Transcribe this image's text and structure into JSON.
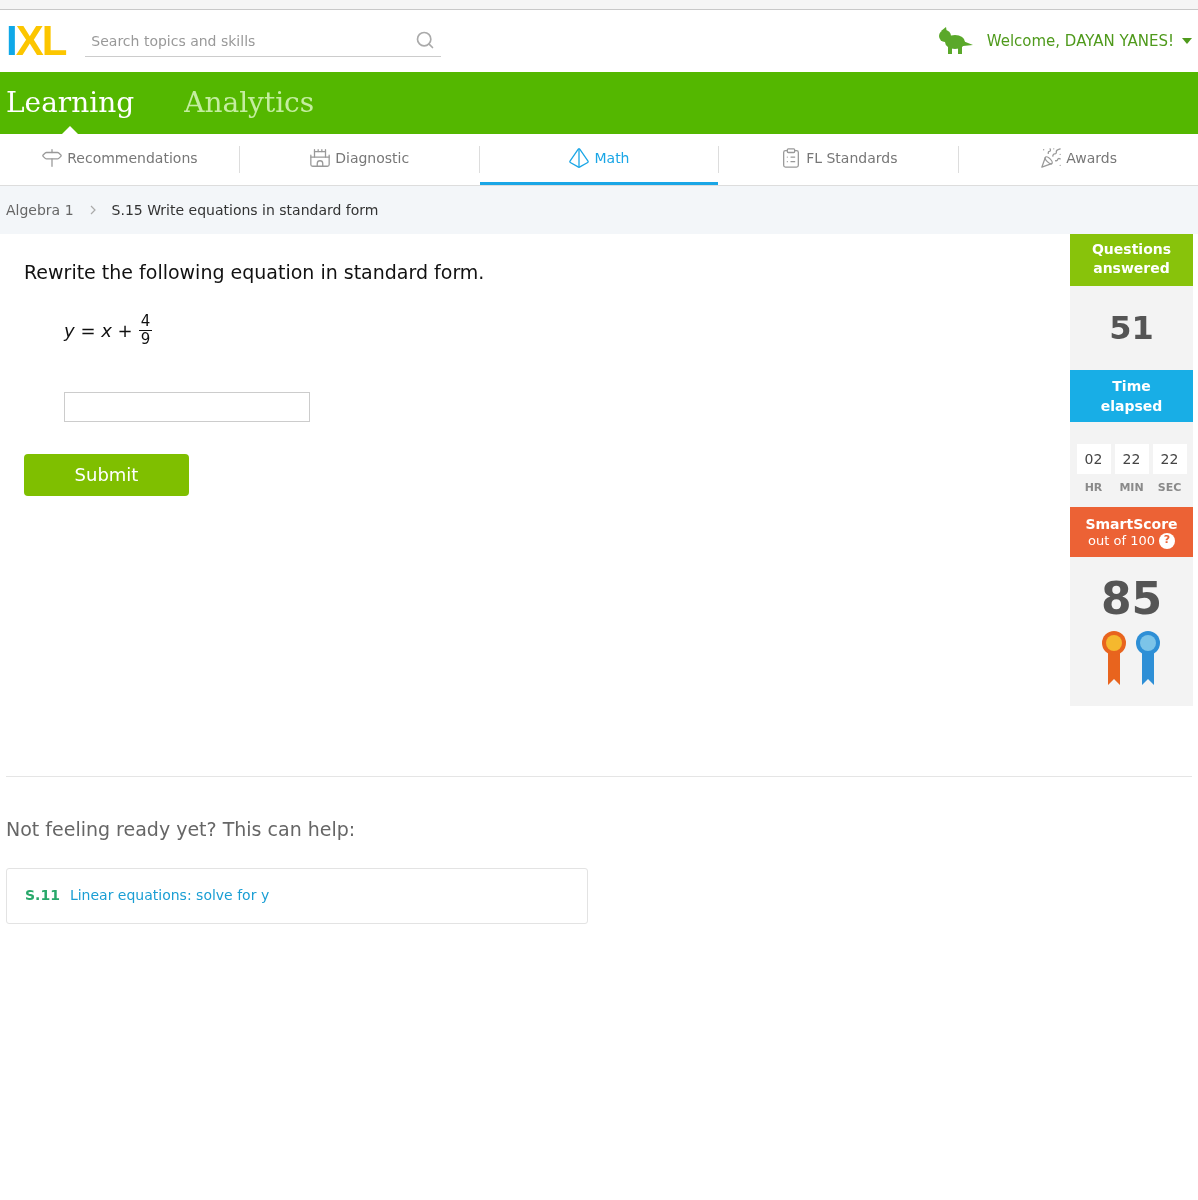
{
  "logo": {
    "letters": [
      {
        "text": "I",
        "color": "#0fa8e8"
      },
      {
        "text": "XL",
        "color": "#fcc600"
      }
    ]
  },
  "search": {
    "placeholder": "Search topics and skills"
  },
  "user": {
    "welcome": "Welcome, DAYAN YANES!"
  },
  "sections": [
    {
      "label": "Learning",
      "selected": true
    },
    {
      "label": "Analytics",
      "selected": false
    }
  ],
  "tabs": [
    {
      "label": "Recommendations",
      "kind": "signpost",
      "selected": false
    },
    {
      "label": "Diagnostic",
      "kind": "castle",
      "selected": false
    },
    {
      "label": "Math",
      "kind": "pyramid",
      "selected": true
    },
    {
      "label": "FL Standards",
      "kind": "clipboard",
      "selected": false
    },
    {
      "label": "Awards",
      "kind": "party",
      "selected": false
    }
  ],
  "breadcrumb": [
    "Algebra 1",
    "S.15 Write equations in standard form"
  ],
  "question": {
    "prompt": "Rewrite the following equation in standard form.",
    "lhs": "*y* = *x* +",
    "numerator": "4",
    "denominator": "9"
  },
  "submit": "Submit",
  "stats": {
    "answered_title": "Questions answered",
    "answered": "51",
    "time_title": "Time elapsed",
    "time": [
      {
        "value": "02",
        "unit": "HR"
      },
      {
        "value": "22",
        "unit": "MIN"
      },
      {
        "value": "22",
        "unit": "SEC"
      }
    ],
    "score_title": "SmartScore",
    "score_subtitle": "out of 100",
    "help": "?",
    "score": "85"
  },
  "help_section": {
    "title": "Not feeling ready yet? This can help:",
    "skills": [
      {
        "code": "S.11",
        "name": "Linear equations: solve for y"
      }
    ]
  }
}
